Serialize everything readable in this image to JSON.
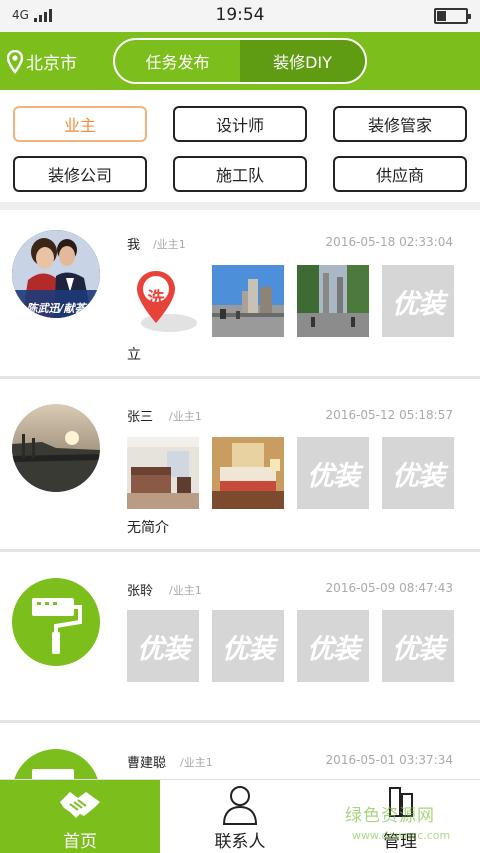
{
  "status_bar": {
    "network": "4G",
    "time": "19:54"
  },
  "header": {
    "city": "北京市",
    "tabs": [
      {
        "label": "任务发布",
        "active": false
      },
      {
        "label": "装修DIY",
        "active": true
      }
    ]
  },
  "roles": [
    {
      "label": "业主",
      "selected": true
    },
    {
      "label": "设计师",
      "selected": false
    },
    {
      "label": "装修管家",
      "selected": false
    },
    {
      "label": "装修公司",
      "selected": false
    },
    {
      "label": "施工队",
      "selected": false
    },
    {
      "label": "供应商",
      "selected": false
    }
  ],
  "placeholder_text": "优装",
  "posts": [
    {
      "name": "我",
      "role": "/业主1",
      "time": "2016-05-18 02:33:04",
      "intro": "立",
      "avatar_text": "陈武迅/献荟",
      "pin_icon_text": "洗"
    },
    {
      "name": "张三",
      "role": "/业主1",
      "time": "2016-05-12 05:18:57",
      "intro": "无简介"
    },
    {
      "name": "张聆",
      "role": "/业主1",
      "time": "2016-05-09 08:47:43",
      "intro": ""
    },
    {
      "name": "曹建聪",
      "role": "/业主1",
      "time": "2016-05-01 03:37:34",
      "intro": ""
    }
  ],
  "bottom_nav": [
    {
      "label": "首页",
      "icon": "handshake-icon",
      "active": true
    },
    {
      "label": "联系人",
      "icon": "person-icon",
      "active": false
    },
    {
      "label": "管理",
      "icon": "manage-icon",
      "active": false
    }
  ],
  "watermark": {
    "title": "绿色资源网",
    "url": "www.downcc.com"
  },
  "colors": {
    "brand_green": "#7cbf1c",
    "segment_active": "#5f9c12",
    "role_selected": "#f08c3c",
    "placeholder": "#d6d6d6"
  }
}
